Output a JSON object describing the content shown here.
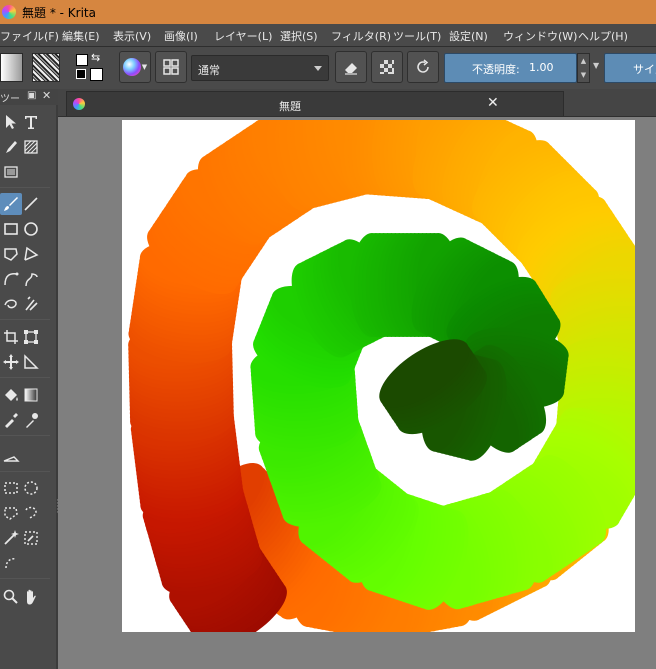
{
  "window": {
    "title": "無題 * - Krita"
  },
  "menu": {
    "items": [
      "ファイル(F)",
      "編集(E)",
      "表示(V)",
      "画像(I)",
      "レイヤー(L)",
      "選択(S)",
      "フィルタ(R)",
      "ツール(T)",
      "設定(N)",
      "ウィンドウ(W)",
      "ヘルプ(H)"
    ]
  },
  "toolbar": {
    "blend_mode": "通常",
    "opacity_label": "不透明度:",
    "opacity_value": "1.00",
    "size_label": "サイズ"
  },
  "toolbox": {
    "title": "ツー"
  },
  "document": {
    "tab_title": "無題"
  },
  "colors": {
    "titlebar": "#d68640",
    "ui_background": "#4a4a4a",
    "accent": "#5d8cb5",
    "canvas_background": "#7f7f7f",
    "paper": "#ffffff",
    "stroke_gradient": [
      "#7a0000",
      "#c81800",
      "#ff6a00",
      "#ff8c00",
      "#ffcc00",
      "#a8ff00",
      "#66ff00",
      "#22dd00",
      "#0b8a00",
      "#1f3a00"
    ]
  }
}
